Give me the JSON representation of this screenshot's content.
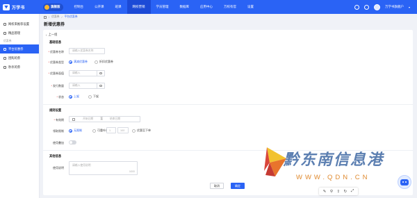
{
  "brand": {
    "name": "万学书",
    "edition": "旗舰版"
  },
  "nav": {
    "items": [
      "控制台",
      "公开课",
      "班课",
      "网校营销",
      "学员管理",
      "数据库",
      "应用中心",
      "万校有官",
      "设置"
    ],
    "active_index": 3
  },
  "topright": {
    "user": "万学书旗舰户"
  },
  "sidebar": {
    "items_top": [
      "网校来推荐设置",
      "精品管理"
    ],
    "group_label": "优惠券",
    "items_group": [
      "平台优惠券",
      "团购的券",
      "秒杀的券"
    ],
    "active": "平台优惠券"
  },
  "breadcrumb": {
    "items": [
      "优惠券",
      "平台优惠券"
    ]
  },
  "page": {
    "title": "新增优惠券",
    "back_label": "上一组"
  },
  "basic": {
    "section_title": "基础信息",
    "name_label": "优惠券名称",
    "name_placeholder": "请输入优惠券名称",
    "type_label": "优惠券类型",
    "type_options": [
      "满减优惠券",
      "折扣优惠券"
    ],
    "type_selected": 0,
    "amount_label": "优惠券面值",
    "amount_placeholder": "请输入",
    "quantity_label": "发行数量",
    "quantity_placeholder": "请输入",
    "status_label": "状态",
    "status_options": [
      "上架",
      "下架"
    ],
    "status_selected": 0
  },
  "rules": {
    "section_title": "规则设置",
    "period_label": "有效期",
    "period_start": "开始日期",
    "period_sep": "至",
    "period_end": "结束日期",
    "limit_label": "领取限制",
    "limit_options": [
      "无限制",
      "可重叶优",
      "优惠至下单"
    ],
    "limit_selected": 0,
    "limit_value": "1",
    "limit_max": "100",
    "stack_label": "使用叠加"
  },
  "other": {
    "section_title": "其他信息",
    "desc_label": "使用说明",
    "desc_placeholder": "请输入使用说明",
    "desc_counter": "0/200"
  },
  "actions": {
    "cancel": "取消",
    "confirm": "确定"
  },
  "watermark": {
    "text": "黔东南信息港",
    "url": "WWW.QDN.CN"
  },
  "floatbar": {
    "icons": [
      "pin-icon",
      "link-icon",
      "share-icon",
      "refresh-icon",
      "collapse-icon"
    ]
  }
}
